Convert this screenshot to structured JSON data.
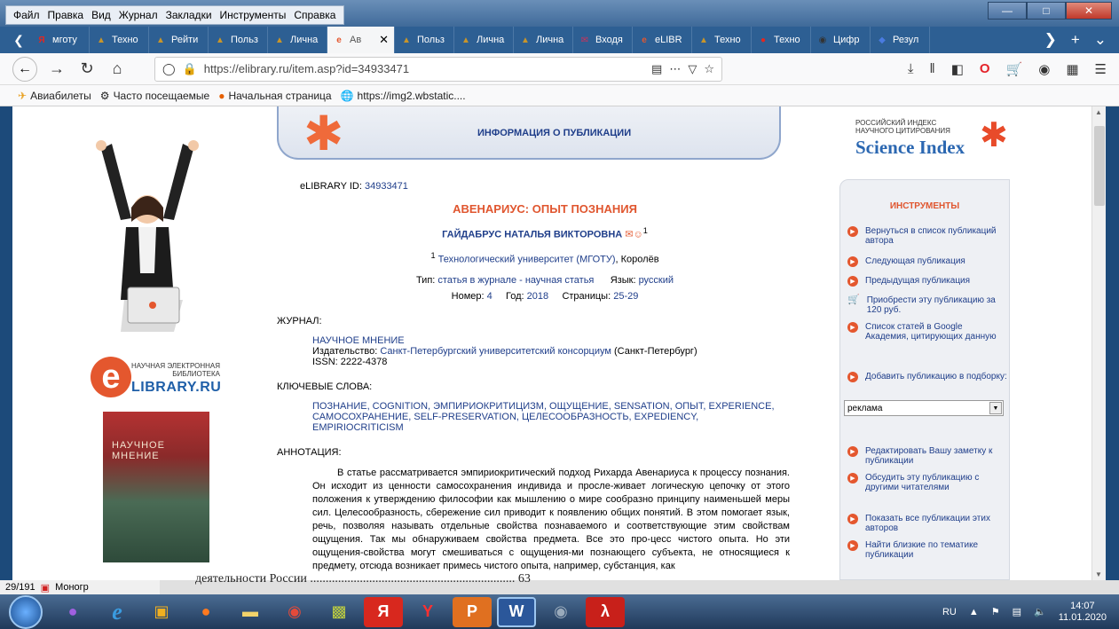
{
  "browser": {
    "menu": [
      "Файл",
      "Правка",
      "Вид",
      "Журнал",
      "Закладки",
      "Инструменты",
      "Справка"
    ],
    "tabs": [
      {
        "label": "мготу",
        "icon": "yandex-icon",
        "color": "#e52620"
      },
      {
        "label": "Техно",
        "icon": "hat-icon",
        "color": "#c8952a"
      },
      {
        "label": "Рейти",
        "icon": "hat-icon",
        "color": "#c8952a"
      },
      {
        "label": "Польз",
        "icon": "hat-icon",
        "color": "#c8952a"
      },
      {
        "label": "Лична",
        "icon": "hat-icon",
        "color": "#c8952a"
      },
      {
        "label": "Ав",
        "icon": "elibrary-icon",
        "color": "#e4572e",
        "active": true
      },
      {
        "label": "Польз",
        "icon": "hat-icon",
        "color": "#c8952a"
      },
      {
        "label": "Лична",
        "icon": "hat-icon",
        "color": "#c8952a"
      },
      {
        "label": "Лична",
        "icon": "hat-icon",
        "color": "#c8952a"
      },
      {
        "label": "Входя",
        "icon": "mail-icon",
        "color": "#d0325a"
      },
      {
        "label": "eLIBR",
        "icon": "elibrary-icon",
        "color": "#e4572e"
      },
      {
        "label": "Техно",
        "icon": "hat-icon",
        "color": "#c8952a"
      },
      {
        "label": "Техно",
        "icon": "pin-icon",
        "color": "#e52620"
      },
      {
        "label": "Цифр",
        "icon": "globe-icon",
        "color": "#333"
      },
      {
        "label": "Резул",
        "icon": "shield-icon",
        "color": "#4a7be0"
      }
    ],
    "url": "https://elibrary.ru/item.asp?id=34933471",
    "bookmarks": [
      "Авиабилеты",
      "Часто посещаемые",
      "Начальная страница",
      "https://img2.wbstatic...."
    ]
  },
  "page": {
    "banner_title": "ИНФОРМАЦИЯ О ПУБЛИКАЦИИ",
    "science_index": {
      "line1": "РОССИЙСКИЙ ИНДЕКС",
      "line2": "НАУЧНОГО ЦИТИРОВАНИЯ",
      "brand": "Science Index"
    },
    "elib_logo": {
      "line1": "НАУЧНАЯ ЭЛЕКТРОННАЯ",
      "line2": "БИБЛИОТЕКА",
      "brand": "LIBRARY.RU"
    },
    "cover_title": "НАУЧНОЕ МНЕНИЕ",
    "elibrary_id_label": "eLIBRARY ID:",
    "elibrary_id": "34933471",
    "title": "АВЕНАРИУС: ОПЫТ ПОЗНАНИЯ",
    "author": "ГАЙДАБРУС НАТАЛЬЯ ВИКТОРОВНА",
    "author_sup": "1",
    "affil_sup": "1",
    "affiliation": "Технологический университет (МГОТУ)",
    "affiliation_city": ", Королёв",
    "type_label": "Тип:",
    "type_value": "статья в журнале - научная статья",
    "lang_label": "Язык:",
    "lang_value": "русский",
    "number_label": "Номер:",
    "number_value": "4",
    "year_label": "Год:",
    "year_value": "2018",
    "pages_label": "Страницы:",
    "pages_value": "25-29",
    "journal_label": "ЖУРНАЛ:",
    "journal_name": "НАУЧНОЕ МНЕНИЕ",
    "publisher_label": "Издательство:",
    "publisher": "Санкт-Петербургский университетский консорциум",
    "publisher_city": " (Санкт-Петербург)",
    "issn": "ISSN: 2222-4378",
    "keywords_label": "КЛЮЧЕВЫЕ СЛОВА:",
    "keywords": "ПОЗНАНИЕ, COGNITION, ЭМПИРИОКРИТИЦИЗМ, ОЩУЩЕНИЕ, SENSATION, ОПЫТ, EXPERIENCE, САМОСОХРАНЕНИЕ, SELF-PRESERVATION, ЦЕЛЕСООБРАЗНОСТЬ, EXPEDIENCY, EMPIRIOCRITICISM",
    "annotation_label": "АННОТАЦИЯ:",
    "annotation": "В статье рассматривается эмпириокритический подход Рихарда Авенариуса к процессу познания. Он исходит из ценности самосохранения индивида и просле-живает логическую цепочку от этого положения к утверждению философии как мышлению о мире сообразно принципу наименьшей меры сил. Целесообразность, сбережение сил приводит к появлению общих понятий. В этом помогает язык, речь, позволяя называть отдельные свойства познаваемого и соответствующие этим свойствам ощущения. Так мы обнаруживаем свойства предмета. Все это про-цесс чистого опыта. Но эти ощущения-свойства могут смешиваться с ощущения-ми познающего субъекта, не относящиеся к предмету, отсюда возникает примесь чистого опыта, например, субстанция, как"
  },
  "tools": {
    "heading": "ИНСТРУМЕНТЫ",
    "items": [
      "Вернуться в список публикаций автора",
      "Следующая публикация",
      "Предыдущая публикация",
      "Приобрести эту публикацию за 120 руб.",
      "Список статей в Google Академия, цитирующих данную",
      "Добавить публикацию в подборку:",
      "Редактировать Вашу заметку к публикации",
      "Обсудить эту публикацию с другими читателями",
      "Показать все публикации этих авторов",
      "Найти близкие по тематике публикации"
    ],
    "select_value": "реклама"
  },
  "underlay": {
    "page_counter": "29/191",
    "doc_label": "Моногр",
    "pdf_fragment": "деятельности России .................................................................. 63"
  },
  "taskbar": {
    "lang": "RU",
    "time": "14:07",
    "date": "11.01.2020"
  }
}
